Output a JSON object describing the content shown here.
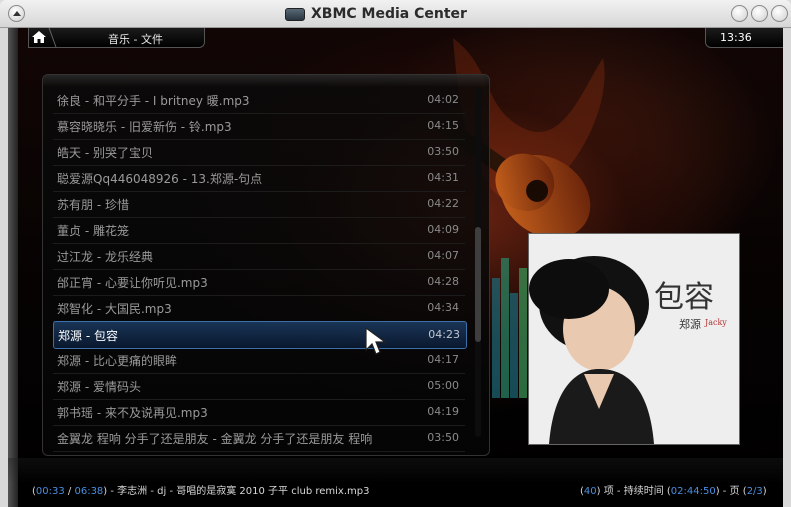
{
  "window": {
    "title": "XBMC Media Center"
  },
  "header": {
    "breadcrumb": "音乐 - 文件",
    "clock": "13:36"
  },
  "list": {
    "items": [
      {
        "name": "徐良 - 和平分手 - I britney 暖.mp3",
        "duration": "04:02"
      },
      {
        "name": "慕容晓晓乐 - 旧爱新伤 - 铃.mp3",
        "duration": "04:15"
      },
      {
        "name": "皓天 - 别哭了宝贝",
        "duration": "03:50"
      },
      {
        "name": "聪爱源Qq446048926 - 13.郑源-句点",
        "duration": "04:31"
      },
      {
        "name": "苏有朋 - 珍惜",
        "duration": "04:22"
      },
      {
        "name": "董贞 - 雕花笼",
        "duration": "04:09"
      },
      {
        "name": "过江龙 - 龙乐经典",
        "duration": "04:07"
      },
      {
        "name": "邰正宵 - 心要让你听见.mp3",
        "duration": "04:28"
      },
      {
        "name": "郑智化 - 大国民.mp3",
        "duration": "04:34"
      },
      {
        "name": "郑源 - 包容",
        "duration": "04:23",
        "selected": true
      },
      {
        "name": "郑源 - 比心更痛的眼眸",
        "duration": "04:17"
      },
      {
        "name": "郑源 - 爱情码头",
        "duration": "05:00"
      },
      {
        "name": "郭书瑶 - 来不及说再见.mp3",
        "duration": "04:19"
      },
      {
        "name": "金翼龙 程响 分手了还是朋友 - 金翼龙 分手了还是朋友 程响",
        "duration": "03:50"
      }
    ]
  },
  "cover": {
    "title_text": "包容",
    "artist_text": "郑源",
    "artist_en": "Jacky"
  },
  "status": {
    "time_elapsed": "00:33",
    "time_total": "06:38",
    "now_playing": "李志洲 - dj - 哥唱的是寂寞 2010 子平 club remix.mp3",
    "item_count": "40",
    "item_label": "项 - 持续时间",
    "total_duration": "02:44:50",
    "page_label": "页",
    "page": "2/3"
  },
  "colors": {
    "accent": "#4a8fe0",
    "selection": "#3d6fa8"
  },
  "icons": {
    "home": "home-icon",
    "app_logo": "xbmc-logo-icon"
  }
}
